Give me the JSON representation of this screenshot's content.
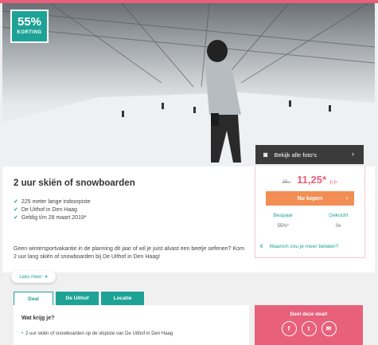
{
  "badge": {
    "percent": "55%",
    "label": "KORTING"
  },
  "photos": {
    "label": "Bekijk alle foto's",
    "icon": "camera-icon"
  },
  "deal": {
    "title": "2 uur skiën of snowboarden",
    "usps": [
      "225 meter lange indoorpiste",
      "De Uithof in Den Haag",
      "Geldig t/m 28 maart 2019*"
    ],
    "description": "Geen wintersportvakantie in de planning dit jaar of wil je juist alvast een beetje oefenen? Kom 2 uur lang skiën of snowboarden bij De Uithof in Den Haag!",
    "more_label": "Lees meer"
  },
  "price": {
    "old": "25,-",
    "new": "11,25*",
    "unit": "p.p.",
    "buy_label": "Nu kopen",
    "save_label": "Bespaar",
    "save_value": "55%*",
    "sold_label": "Gekocht",
    "sold_value": "0x",
    "why_label": "Waarom zou je meer betalen?",
    "why_icon": "€"
  },
  "tabs": [
    "Deal",
    "De Uithof",
    "Locatie"
  ],
  "content": {
    "heading": "Wat krijg je?",
    "items": [
      "2 uur skiën of snowboarden op de skipiste van De Uithof in Den Haag"
    ]
  },
  "share": {
    "title": "Deel deze deal!",
    "icons": [
      "facebook-icon",
      "twitter-icon",
      "mail-icon"
    ]
  },
  "colors": {
    "accent": "#1ea296",
    "brand": "#e8607a",
    "button": "#f28e53"
  }
}
